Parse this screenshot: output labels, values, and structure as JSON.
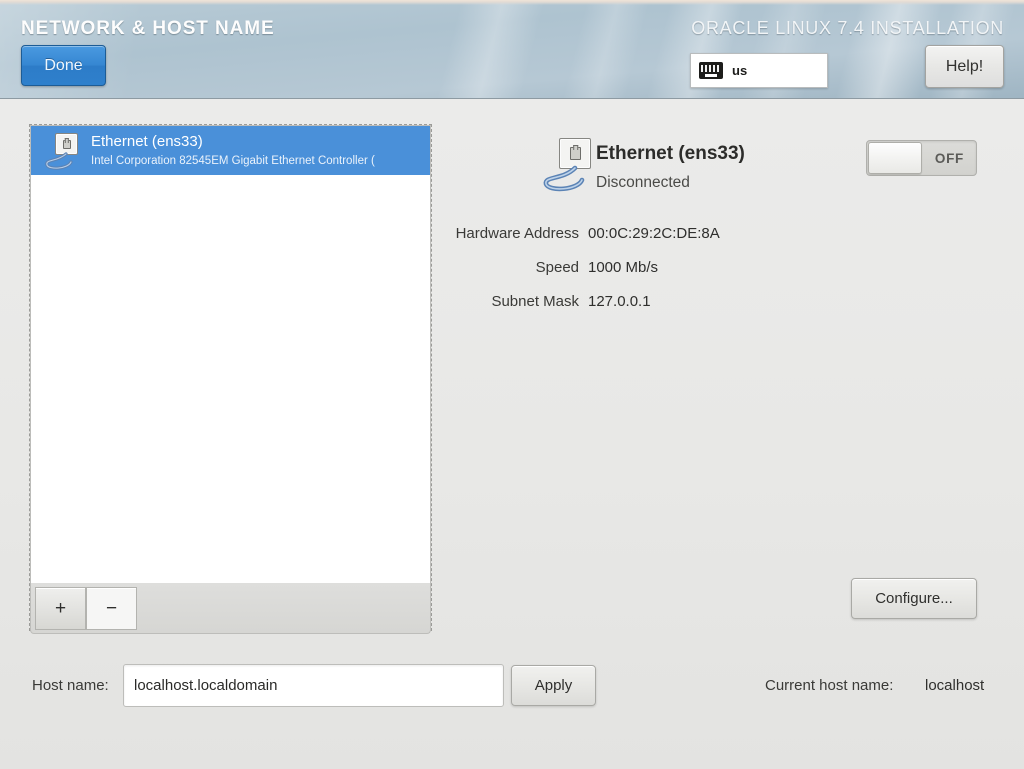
{
  "header": {
    "title": "NETWORK & HOST NAME",
    "installation_label": "ORACLE LINUX 7.4 INSTALLATION",
    "done_label": "Done",
    "help_label": "Help!",
    "keyboard_layout": "us",
    "keyboard_icon": "keyboard-icon"
  },
  "device_list": {
    "items": [
      {
        "icon": "network-wired-icon",
        "name": "Ethernet (ens33)",
        "description": "Intel Corporation 82545EM Gigabit Ethernet Controller (",
        "selected": true
      }
    ],
    "toolbar": {
      "add_label": "+",
      "remove_label": "−"
    }
  },
  "detail": {
    "icon": "network-wired-icon",
    "name": "Ethernet (ens33)",
    "status": "Disconnected",
    "rows": [
      {
        "label": "Hardware Address",
        "value": "00:0C:29:2C:DE:8A"
      },
      {
        "label": "Speed",
        "value": "1000 Mb/s"
      },
      {
        "label": "Subnet Mask",
        "value": "127.0.0.1"
      }
    ],
    "toggle": {
      "state_label": "OFF",
      "on": false
    },
    "configure_label": "Configure..."
  },
  "host": {
    "label": "Host name:",
    "value": "localhost.localdomain",
    "placeholder": "",
    "apply_label": "Apply",
    "current_label": "Current host name:",
    "current_value": "localhost"
  },
  "colors": {
    "selection_blue": "#4a90d9",
    "done_blue": "#3687d2",
    "header_blue": "#aec3d0",
    "page_bg": "#e8e8e6"
  }
}
